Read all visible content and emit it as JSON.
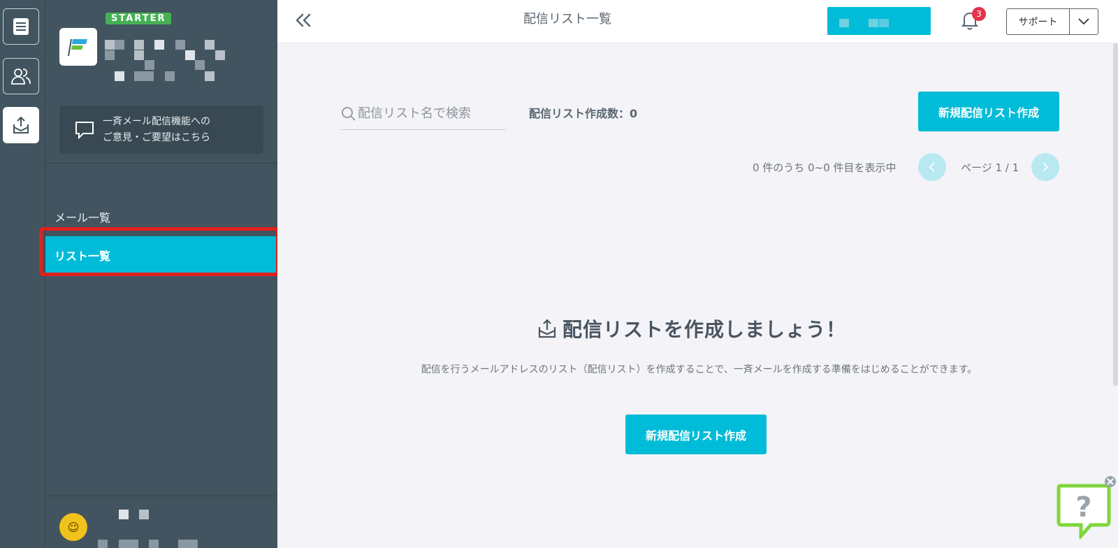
{
  "sidebar": {
    "plan_badge": "STARTER",
    "feedback": {
      "line1": "一斉メール配信機能への",
      "line2": "ご意見・ご要望はこちら"
    },
    "nav": [
      {
        "label": "メール一覧",
        "active": false
      },
      {
        "label": "リスト一覧",
        "active": true
      }
    ]
  },
  "header": {
    "title": "配信リスト一覧",
    "notification_count": "3",
    "support_label": "サポート"
  },
  "toolbar": {
    "search_placeholder": "配信リスト名で検索",
    "list_count": "配信リスト作成数：0",
    "create_label": "新規配信リスト作成"
  },
  "pagination": {
    "range_text": "0 件のうち 0~0 件目を表示中",
    "page_text": "ページ 1 / 1"
  },
  "empty_state": {
    "title": "配信リストを作成しましょう！",
    "description": "配信を行うメールアドレスのリスト（配信リスト）を作成することで、一斉メールを作成する準備をはじめることができます。",
    "create_label": "新規配信リスト作成"
  },
  "colors": {
    "accent": "#00bcd8",
    "sidebar_bg": "#42545f",
    "highlight": "#e3201b",
    "plan_badge": "#45b154"
  },
  "icons": [
    "document-list-icon",
    "users-icon",
    "mail-send-icon",
    "chat-bubble-icon",
    "collapse-left-icon",
    "bell-icon",
    "chevron-down-icon",
    "search-icon",
    "chevron-left-icon",
    "chevron-right-icon",
    "help-question-icon",
    "close-icon"
  ]
}
